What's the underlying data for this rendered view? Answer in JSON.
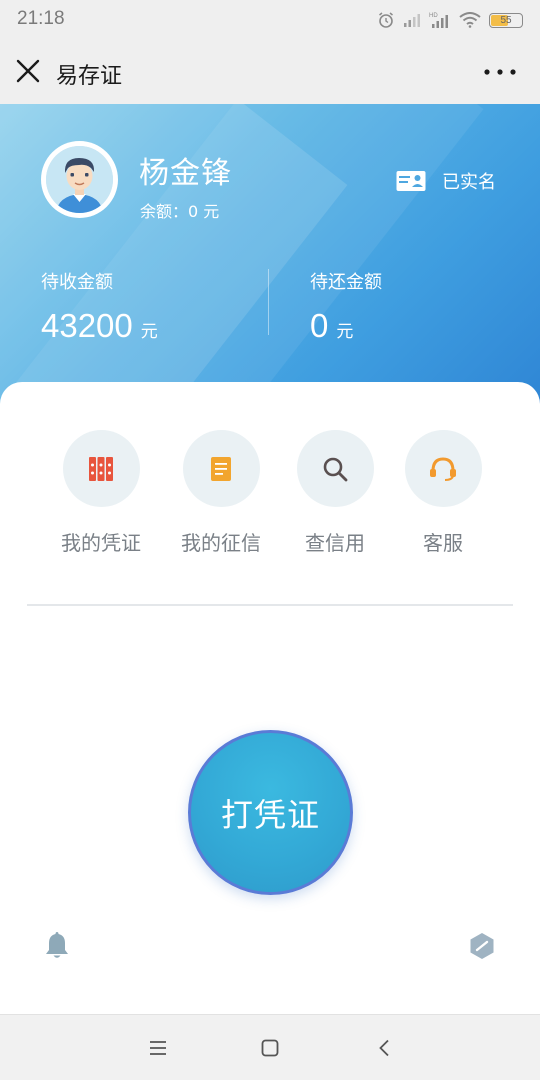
{
  "status_bar": {
    "time": "21:18",
    "icons": [
      "alarm-icon",
      "signal-icon",
      "hd-signal-icon",
      "wifi-icon"
    ],
    "battery_level": "55"
  },
  "title_bar": {
    "title": "易存证",
    "close_icon": "close-icon",
    "more_icon": "more-dots-icon"
  },
  "profile": {
    "name": "杨金锋",
    "balance": "余额：0 元",
    "verified_label": "已实名",
    "verified_icon": "id-card-icon"
  },
  "stats": [
    {
      "label": "待收金额",
      "value": "43200",
      "unit": "元"
    },
    {
      "label": "待还金额",
      "value": "0",
      "unit": "元"
    }
  ],
  "functions": [
    {
      "label": "我的凭证",
      "icon": "binders-icon",
      "color": "#e8553d"
    },
    {
      "label": "我的征信",
      "icon": "document-icon",
      "color": "#f2a52e"
    },
    {
      "label": "查信用",
      "icon": "search-icon",
      "color": "#5a5050"
    },
    {
      "label": "客服",
      "icon": "headset-icon",
      "color": "#f29a2e"
    }
  ],
  "main_action": {
    "label": "打凭证"
  },
  "bottom_icons": [
    "bell-icon",
    "hexagon-icon"
  ],
  "colors": {
    "banner_start": "#8fd0ec",
    "banner_end": "#2f86d5",
    "button": "#33a9d6",
    "button_border": "#5a7bd6"
  }
}
